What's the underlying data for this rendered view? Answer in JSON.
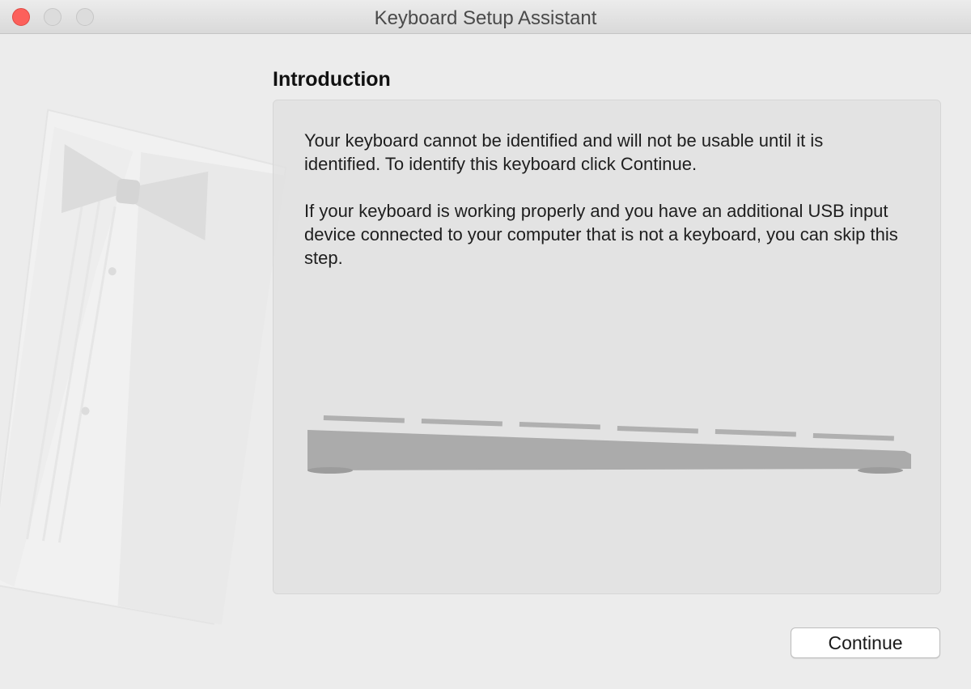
{
  "window": {
    "title": "Keyboard Setup Assistant"
  },
  "titlebar": {
    "buttons": [
      "close",
      "minimize",
      "zoom"
    ],
    "colors": {
      "close": "#fc605b",
      "inactive": "#dcdcdc"
    }
  },
  "content": {
    "heading": "Introduction",
    "paragraph1": "Your keyboard cannot be identified and will not be usable until it is identified. To identify this keyboard click Continue.",
    "paragraph2": "If your keyboard is working properly and you have an additional USB input device connected to your computer that is not a keyboard, you can skip this step."
  },
  "footer": {
    "continue_label": "Continue"
  },
  "icons": {
    "illustration": "tuxedo-illustration",
    "keyboard": "keyboard-side-view-icon"
  }
}
